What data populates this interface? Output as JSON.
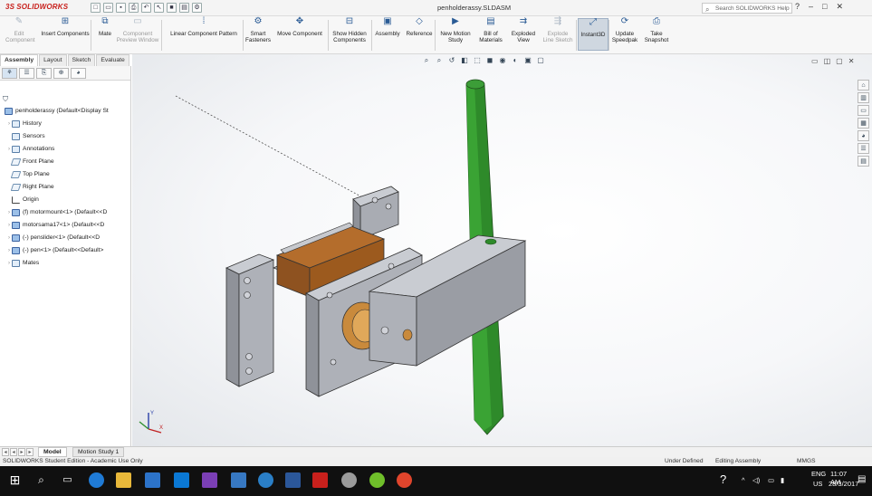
{
  "titlebar": {
    "logo_ds": "3S",
    "logo_text": "SOLIDWORKS",
    "filename": "penholderassy.SLDASM",
    "search_placeholder": "Search SOLIDWORKS Help",
    "help_glyph": "?",
    "minimize_glyph": "–",
    "restore_glyph": "□",
    "close_glyph": "✕"
  },
  "command_manager": {
    "items": [
      {
        "line1": "Edit",
        "line2": "Component",
        "enabled": false
      },
      {
        "line1": "Insert Components",
        "line2": "",
        "enabled": true
      },
      {
        "line1": "Mate",
        "line2": "",
        "enabled": true
      },
      {
        "line1": "Component",
        "line2": "Preview Window",
        "enabled": false
      },
      {
        "line1": "Linear Component Pattern",
        "line2": "",
        "enabled": true
      },
      {
        "line1": "Smart",
        "line2": "Fasteners",
        "enabled": true
      },
      {
        "line1": "Move Component",
        "line2": "",
        "enabled": true
      },
      {
        "line1": "Show Hidden",
        "line2": "Components",
        "enabled": true
      },
      {
        "line1": "Assembly",
        "line2": "",
        "enabled": true
      },
      {
        "line1": "Reference",
        "line2": "",
        "enabled": true
      },
      {
        "line1": "New Motion",
        "line2": "Study",
        "enabled": true
      },
      {
        "line1": "Bill of",
        "line2": "Materials",
        "enabled": true
      },
      {
        "line1": "Exploded",
        "line2": "View",
        "enabled": true
      },
      {
        "line1": "Explode",
        "line2": "Line Sketch",
        "enabled": false
      },
      {
        "line1": "Instant3D",
        "line2": "",
        "enabled": true,
        "active": true
      },
      {
        "line1": "Update",
        "line2": "Speedpak",
        "enabled": true
      },
      {
        "line1": "Take",
        "line2": "Snapshot",
        "enabled": true
      }
    ]
  },
  "tabs": [
    "Assembly",
    "Layout",
    "Sketch",
    "Evaluate"
  ],
  "active_tab": "Assembly",
  "feature_tree": {
    "filter_icon": "funnel-icon",
    "items": [
      {
        "label": "penholderassy  (Default<Display St",
        "icon": "assembly-icon",
        "expander": ""
      },
      {
        "label": "History",
        "icon": "history-icon",
        "expander": "›"
      },
      {
        "label": "Sensors",
        "icon": "sensors-icon",
        "expander": ""
      },
      {
        "label": "Annotations",
        "icon": "annotations-icon",
        "expander": "›"
      },
      {
        "label": "Front Plane",
        "icon": "plane-icon",
        "expander": ""
      },
      {
        "label": "Top Plane",
        "icon": "plane-icon",
        "expander": ""
      },
      {
        "label": "Right Plane",
        "icon": "plane-icon",
        "expander": ""
      },
      {
        "label": "Origin",
        "icon": "origin-icon",
        "expander": ""
      },
      {
        "label": "(f) motormount<1> (Default<<D",
        "icon": "component-icon",
        "expander": "›"
      },
      {
        "label": "motorsama17<1> (Default<<D",
        "icon": "component-icon",
        "expander": "›"
      },
      {
        "label": "(-) penslider<1> (Default<<D",
        "icon": "component-icon",
        "expander": "›"
      },
      {
        "label": "(-) pen<1> (Default<<Default>",
        "icon": "component-icon",
        "expander": "›"
      },
      {
        "label": "Mates",
        "icon": "mates-icon",
        "expander": "›"
      }
    ]
  },
  "bottom_tabs": [
    "Model",
    "Motion Study 1"
  ],
  "active_bottom_tab": "Model",
  "status_bar": {
    "left": "SOLIDWORKS Student Edition - Academic Use Only",
    "defined": "Under Defined",
    "mode": "Editing Assembly",
    "units": "MMGS"
  },
  "taskbar": {
    "language": "ENG",
    "region": "US",
    "time": "11:07 AM",
    "date": "28/3/2017",
    "app_icons": [
      "windows-start-icon",
      "search-icon",
      "task-view-icon",
      "edge-icon",
      "file-explorer-icon",
      "store-icon",
      "visual-studio-icon",
      "powershell-icon",
      "settings-icon",
      "word-icon",
      "solidworks-icon",
      "app-icon",
      "green-app-icon",
      "chrome-icon"
    ]
  },
  "colors": {
    "accent_red": "#c8201c",
    "part_gray": "#a9acb3",
    "motor_brown": "#9c5a1e",
    "pen_green": "#2e8a2a",
    "taskbar": "#101010"
  }
}
